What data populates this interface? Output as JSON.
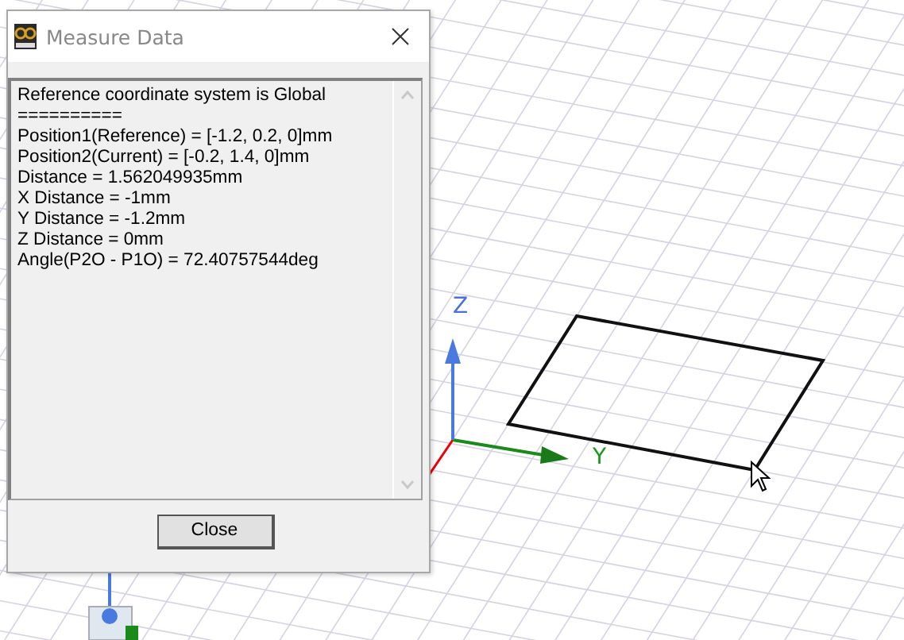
{
  "window": {
    "title": "Measure Data"
  },
  "report_lines": [
    "Reference coordinate system is Global",
    "==========",
    "Position1(Reference) = [-1.2, 0.2, 0]mm",
    "Position2(Current) = [-0.2, 1.4, 0]mm",
    "Distance = 1.562049935mm",
    "X Distance = -1mm",
    "Y Distance = -1.2mm",
    "Z Distance = 0mm",
    "Angle(P2O - P1O) = 72.40757544deg"
  ],
  "buttons": [
    "Close"
  ],
  "viewport": {
    "axis_labels": [
      "Z",
      "Y"
    ]
  }
}
